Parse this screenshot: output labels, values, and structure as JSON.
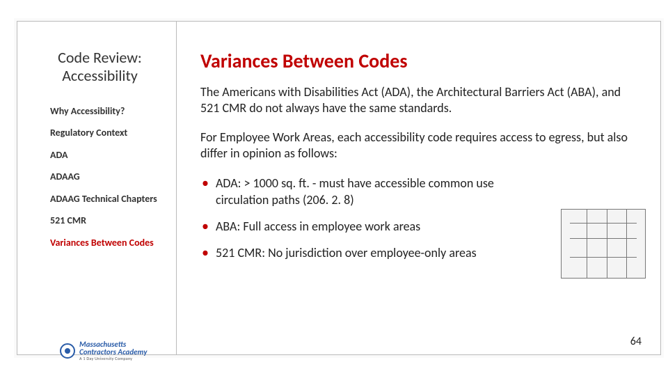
{
  "sidebar": {
    "title_line1": "Code Review:",
    "title_line2": "Accessibility",
    "items": [
      {
        "label": "Why Accessibility?",
        "active": false
      },
      {
        "label": "Regulatory Context",
        "active": false
      },
      {
        "label": "ADA",
        "active": false
      },
      {
        "label": "ADAAG",
        "active": false
      },
      {
        "label": "ADAAG Technical Chapters",
        "active": false
      },
      {
        "label": "521 CMR",
        "active": false
      },
      {
        "label": "Variances Between Codes",
        "active": true
      }
    ]
  },
  "main": {
    "title": "Variances Between Codes",
    "para1": "The Americans with Disabilities Act (ADA), the Architectural Barriers Act (ABA), and 521 CMR do not always have the same standards.",
    "para2": "For Employee Work Areas, each accessibility code requires access to egress, but also differ in opinion as follows:",
    "bullets": [
      "ADA: > 1000 sq. ft. - must have accessible common use circulation paths (206. 2. 8)",
      "ABA: Full access in employee work areas",
      "521 CMR: No jurisdiction over employee-only areas"
    ]
  },
  "footer": {
    "page_number": "64",
    "logo": {
      "line1": "Massachusetts",
      "line2": "Contractors Academy",
      "tagline": "A 1 Day University Company"
    }
  }
}
